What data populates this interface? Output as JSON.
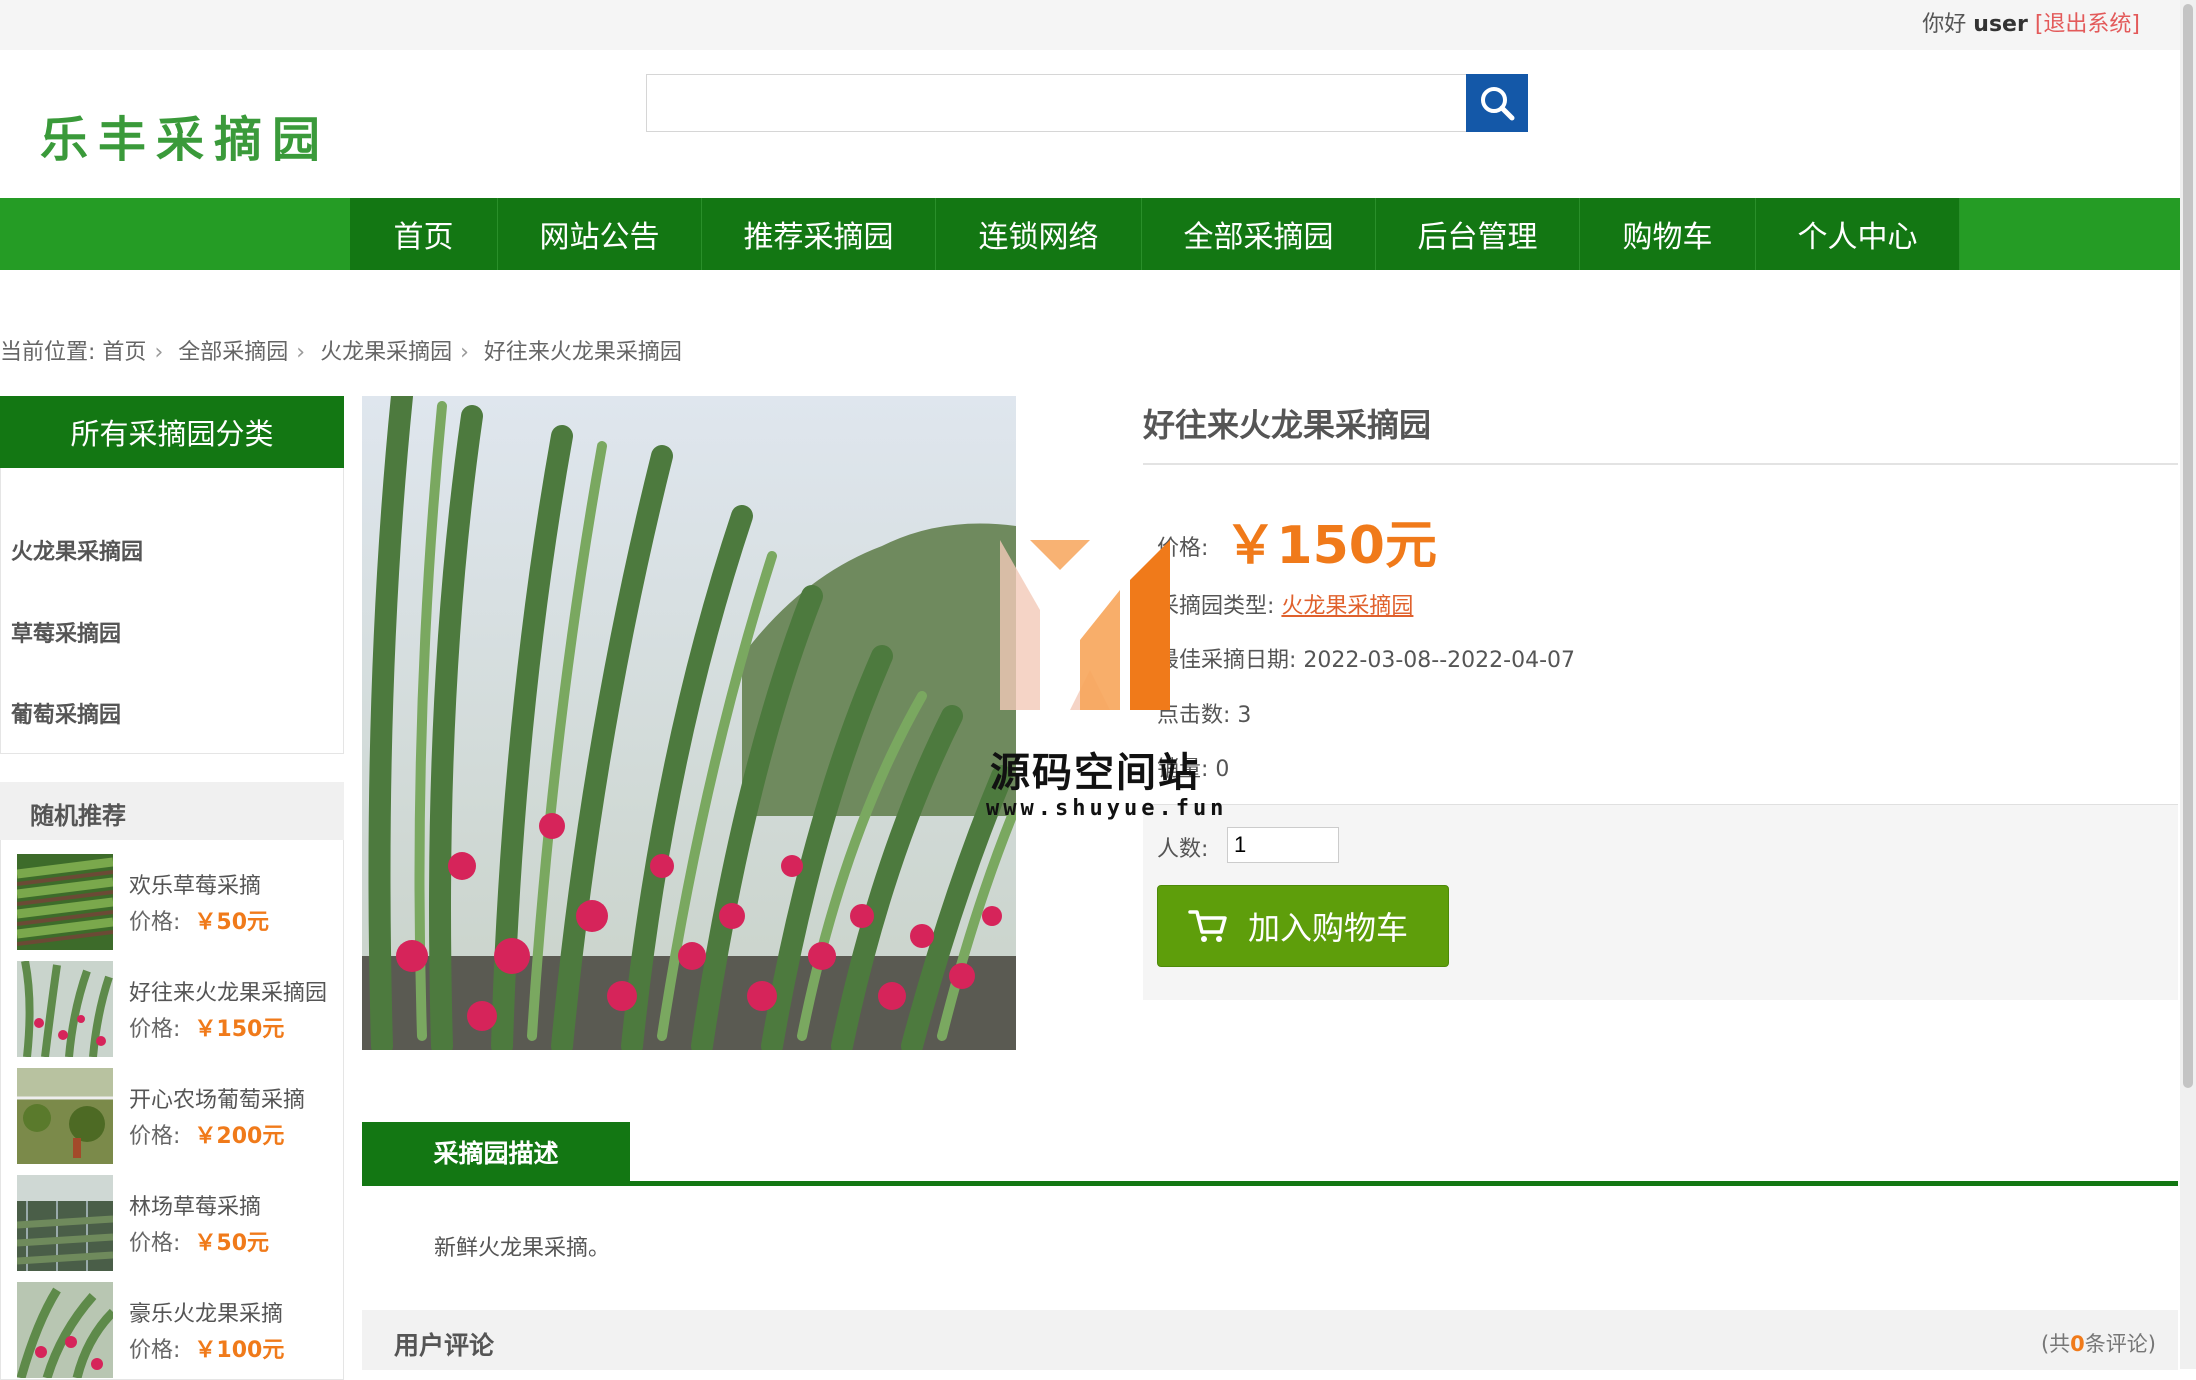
{
  "topbar": {
    "greeting": "你好",
    "username": "user",
    "logout": "[退出系统]"
  },
  "logo": {
    "text": "乐丰采摘园"
  },
  "search": {
    "value": "",
    "placeholder": "",
    "icon": "search-icon"
  },
  "nav": [
    "首页",
    "网站公告",
    "推荐采摘园",
    "连锁网络",
    "全部采摘园",
    "后台管理",
    "购物车",
    "个人中心"
  ],
  "breadcrumb": {
    "prefix": "当前位置:",
    "items": [
      "首页",
      "全部采摘园",
      "火龙果采摘园",
      "好往来火龙果采摘园"
    ]
  },
  "categories": {
    "title": "所有采摘园分类",
    "items": [
      "火龙果采摘园",
      "草莓采摘园",
      "葡萄采摘园"
    ]
  },
  "random": {
    "title": "随机推荐",
    "price_label": "价格:",
    "items": [
      {
        "name": "欢乐草莓采摘",
        "price": "￥50元"
      },
      {
        "name": "好往来火龙果采摘园",
        "price": "￥150元"
      },
      {
        "name": "开心农场葡萄采摘",
        "price": "￥200元"
      },
      {
        "name": "林场草莓采摘",
        "price": "￥50元"
      },
      {
        "name": "豪乐火龙果采摘",
        "price": "￥100元"
      }
    ]
  },
  "product": {
    "title": "好往来火龙果采摘园",
    "price_label": "价格:",
    "price": "￥150元",
    "type_label": "采摘园类型:",
    "type": "火龙果采摘园",
    "date_label": "最佳采摘日期:",
    "date": "2022-03-08--2022-04-07",
    "clicks_label": "点击数:",
    "clicks": "3",
    "sales_label": "销量:",
    "sales": "0",
    "qty_label": "人数:",
    "qty": "1",
    "add_cart": "加入购物车"
  },
  "tabs": {
    "description": "采摘园描述"
  },
  "description": "新鲜火龙果采摘。",
  "comments": {
    "title": "用户评论",
    "count_prefix": "(共",
    "count": "0",
    "count_suffix": "条评论)"
  },
  "watermark": {
    "title": "源码空间站",
    "url": "www.shuyue.fun"
  },
  "colors": {
    "nav_green": "#137713",
    "light_green": "#259c25",
    "price_orange": "#f07a1a",
    "search_blue": "#1458a8",
    "button_green": "#5e9e0b"
  }
}
